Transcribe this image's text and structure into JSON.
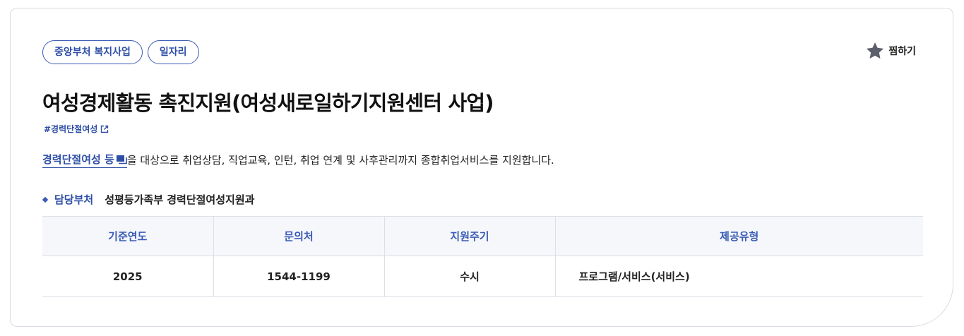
{
  "tags": [
    "중앙부처 복지사업",
    "일자리"
  ],
  "favorite": {
    "label": "찜하기",
    "icon": "star-icon"
  },
  "title": "여성경제활동 촉진지원(여성새로일하기지원센터 사업)",
  "hashtag": {
    "label": "#경력단절여성",
    "icon": "external-link-icon"
  },
  "description": {
    "target_link": "경력단절여성 등",
    "target_icon": "copy-icon",
    "text": "을 대상으로 취업상담, 직업교육, 인턴, 취업 연계 및 사후관리까지 종합취업서비스를 지원합니다."
  },
  "department": {
    "label": "담당부처",
    "value": "성평등가족부 경력단절여성지원과"
  },
  "table": {
    "headers": [
      "기준연도",
      "문의처",
      "지원주기",
      "제공유형"
    ],
    "row": [
      "2025",
      "1544-1199",
      "수시",
      "프로그램/서비스(서비스)"
    ]
  },
  "colors": {
    "accent": "#2e4ea6",
    "header_bg": "#f5f7fb",
    "star": "#5a5f6b"
  }
}
